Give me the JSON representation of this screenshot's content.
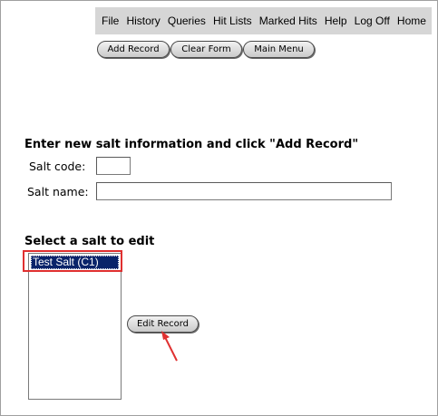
{
  "menu": {
    "items": [
      "File",
      "History",
      "Queries",
      "Hit Lists",
      "Marked Hits",
      "Help",
      "Log Off",
      "Home"
    ]
  },
  "toolbar": {
    "add_record": "Add Record",
    "clear_form": "Clear Form",
    "main_menu": "Main Menu"
  },
  "new_salt": {
    "heading": "Enter new salt information and click \"Add Record\"",
    "code_label": "Salt code:",
    "code_value": "",
    "name_label": "Salt name:",
    "name_value": ""
  },
  "edit_salt": {
    "heading": "Select a salt to edit",
    "options": [
      "Test Salt (C1)"
    ],
    "selected": "Test Salt (C1)",
    "edit_button": "Edit Record"
  },
  "colors": {
    "menubar_bg": "#d6d6d6",
    "selection_bg": "#0a246a",
    "annotation": "#e03030"
  }
}
